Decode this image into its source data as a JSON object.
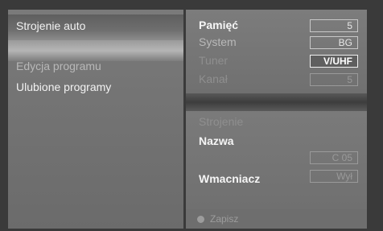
{
  "left_menu": {
    "items": [
      {
        "label": "Strojenie auto"
      },
      {
        "label": "Edycja programu"
      },
      {
        "label": "Ulubione programy"
      }
    ]
  },
  "tuning_panel": {
    "rows": [
      {
        "label": "Pamięć",
        "value": "5"
      },
      {
        "label": "System",
        "value": "BG"
      },
      {
        "label": "Tuner",
        "value": "V/UHF"
      },
      {
        "label": "Kanał",
        "value": "5"
      }
    ]
  },
  "edit_panel": {
    "strojenie_label": "Strojenie",
    "nazwa_label": "Nazwa",
    "nazwa_value": "C 05",
    "wzmacniacz_label": "Wmacniacz",
    "wzmacniacz_value": "Wył"
  },
  "footer": {
    "save_label": "Zapisz"
  }
}
